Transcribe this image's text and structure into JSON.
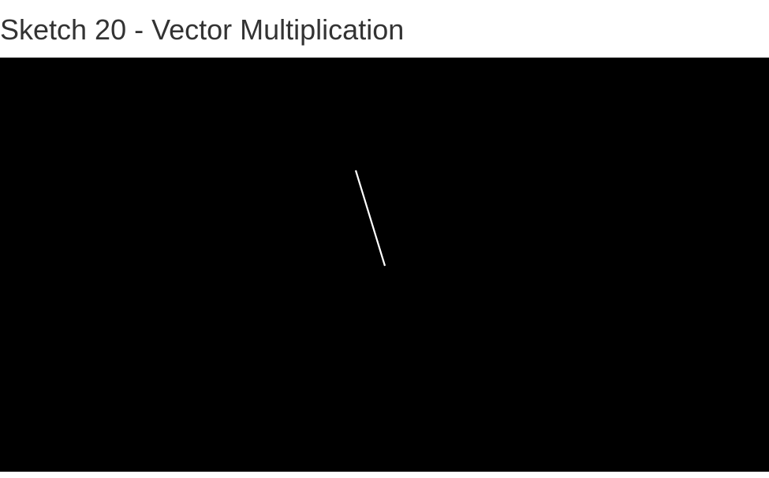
{
  "page": {
    "title": "Sketch 20 - Vector Multiplication"
  },
  "canvas": {
    "background": "#000000",
    "stroke": "#ffffff"
  }
}
